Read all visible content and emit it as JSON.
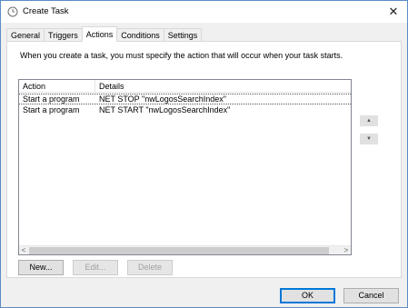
{
  "window": {
    "title": "Create Task",
    "close_glyph": "✕"
  },
  "tabs": [
    {
      "label": "General"
    },
    {
      "label": "Triggers"
    },
    {
      "label": "Actions",
      "active": true
    },
    {
      "label": "Conditions"
    },
    {
      "label": "Settings"
    }
  ],
  "actions_panel": {
    "instruction": "When you create a task, you must specify the action that will occur when your task starts.",
    "columns": [
      "Action",
      "Details"
    ],
    "rows": [
      {
        "action": "Start a program",
        "details": "NET STOP \"nwLogosSearchIndex\"",
        "selected": true
      },
      {
        "action": "Start a program",
        "details": "NET START \"nwLogosSearchIndex\"",
        "selected": false
      }
    ],
    "buttons": {
      "new": "New...",
      "edit": "Edit...",
      "delete": "Delete"
    },
    "move_up_glyph": "▲",
    "move_down_glyph": "▼",
    "scroll_left_glyph": "<",
    "scroll_right_glyph": ">"
  },
  "footer": {
    "ok": "OK",
    "cancel": "Cancel"
  },
  "icons": {
    "title_icon": "clock-icon",
    "close": "close-icon"
  },
  "colors": {
    "window_border": "#5a8bc7",
    "ok_focus_border": "#0078d7",
    "disabled_text": "#a0a0a0"
  }
}
